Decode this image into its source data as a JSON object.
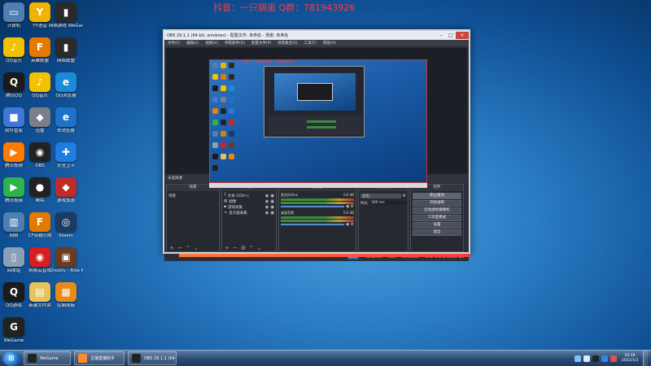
{
  "overlay": {
    "watermark": "抖音：一只锅蛋  Q群：781943926"
  },
  "desktop": {
    "icons": [
      {
        "label": "计算机",
        "glyph": "▭",
        "color": "#4e7fb0"
      },
      {
        "label": "YY语音",
        "glyph": "Y",
        "color": "#f2b200"
      },
      {
        "label": "网络游戏 WeGame版",
        "glyph": "▮",
        "color": "#2a2a2a"
      },
      {
        "label": "QQ音乐",
        "glyph": "♪",
        "color": "#f2c200"
      },
      {
        "label": "英雄联盟",
        "glyph": "F",
        "color": "#e47a00"
      },
      {
        "label": "网络联盟",
        "glyph": "▮",
        "color": "#2a2a2a"
      },
      {
        "label": "腾讯QQ",
        "glyph": "Q",
        "color": "#1b1b1b"
      },
      {
        "label": "QQ音乐",
        "glyph": "♪",
        "color": "#f2c200"
      },
      {
        "label": "QQ浏览器",
        "glyph": "e",
        "color": "#1c8ad8"
      },
      {
        "label": "软件管家",
        "glyph": "■",
        "color": "#3f77d6"
      },
      {
        "label": "迅雷",
        "glyph": "◆",
        "color": "#7a7f8a"
      },
      {
        "label": "IE浏览器",
        "glyph": "e",
        "color": "#1e73c8"
      },
      {
        "label": "腾讯视频",
        "glyph": "▶",
        "color": "#ff7a00"
      },
      {
        "label": "OBS",
        "glyph": "◉",
        "color": "#222"
      },
      {
        "label": "安全卫士",
        "glyph": "✚",
        "color": "#1f7ce0"
      },
      {
        "label": "腾讯视频",
        "glyph": "▶",
        "color": "#2cb34a"
      },
      {
        "label": "咪咕",
        "glyph": "●",
        "color": "#222"
      },
      {
        "label": "游戏加速",
        "glyph": "◆",
        "color": "#c02a2a"
      },
      {
        "label": "网络",
        "glyph": "▥",
        "color": "#4e7fb0"
      },
      {
        "label": "CF穿越火线",
        "glyph": "F",
        "color": "#e47a00"
      },
      {
        "label": "Steam",
        "glyph": "◎",
        "color": "#1b3b60"
      },
      {
        "label": "回收站",
        "glyph": "▯",
        "color": "#8aa0b8"
      },
      {
        "label": "网易云音乐",
        "glyph": "◉",
        "color": "#d81e1e"
      },
      {
        "label": "Ghostly - Rise Kanem...",
        "glyph": "▣",
        "color": "#6b3b20"
      },
      {
        "label": "QQ游戏",
        "glyph": "Q",
        "color": "#1b1b1b"
      },
      {
        "label": "新建文件夹",
        "glyph": "▤",
        "color": "#e8c25a"
      },
      {
        "label": "控制面板",
        "glyph": "▦",
        "color": "#e88a1a"
      },
      {
        "label": "WeGame",
        "glyph": "G",
        "color": "#222"
      }
    ]
  },
  "obs": {
    "title": "OBS 26.1.1 (64-bit, windows) - 配置文件: 未命名 - 场景: 未命名",
    "controls": {
      "minimize": "–",
      "maximize": "□",
      "close": "×"
    },
    "menu": [
      "文件(F)",
      "编辑(E)",
      "视图(V)",
      "停靠部件(D)",
      "配置文件(P)",
      "场景集合(S)",
      "工具(T)",
      "帮助(H)"
    ],
    "preview_caption": "抖音：一只锅蛋  Q群：781943926",
    "scene_bar": {
      "label": "未选择源",
      "toggle1": "属性",
      "toggle2": "滤镜"
    },
    "docks": {
      "scenes": {
        "title": "场景",
        "item": "场景"
      },
      "sources": {
        "title": "来源",
        "items": [
          "文本 (GDI+)",
          "图像",
          "游戏采集",
          "显示器采集"
        ]
      },
      "mixer": {
        "title": "混音器",
        "tracks": [
          {
            "name": "麦克风/Aux",
            "db": "0.0 dB"
          },
          {
            "name": "桌面音频",
            "db": "0.0 dB"
          }
        ]
      },
      "transitions": {
        "title": "转场特效",
        "type": "淡出",
        "duration_label": "时长",
        "duration": "300 ms"
      },
      "controls": {
        "title": "控件",
        "buttons": [
          "停止推流",
          "开始录制",
          "启动虚拟摄像机",
          "工作室模式",
          "设置",
          "退出"
        ]
      }
    },
    "status": {
      "live": "LIVE",
      "live_time": "00:00:00",
      "rec": "REC",
      "rec_time": "00:00:00",
      "cpu": "CPU: 2.3%, 30.00 fps"
    }
  },
  "taskbar": {
    "start": "⊞",
    "tasks": [
      {
        "label": "WeGame",
        "color": "#222"
      },
      {
        "label": "主播直播助手",
        "color": "#ff8a2a"
      },
      {
        "label": "OBS 26.1.1 (64-bit...",
        "color": "#222"
      }
    ],
    "tray_icons": [
      {
        "name": "network",
        "color": "#7fc0ff"
      },
      {
        "name": "volume",
        "color": "#dfe8f3"
      },
      {
        "name": "qq",
        "color": "#222"
      },
      {
        "name": "shield",
        "color": "#2b8ae0"
      },
      {
        "name": "input",
        "color": "#e05050"
      }
    ],
    "clock_time": "20:18",
    "clock_date": "2022/1/3"
  }
}
